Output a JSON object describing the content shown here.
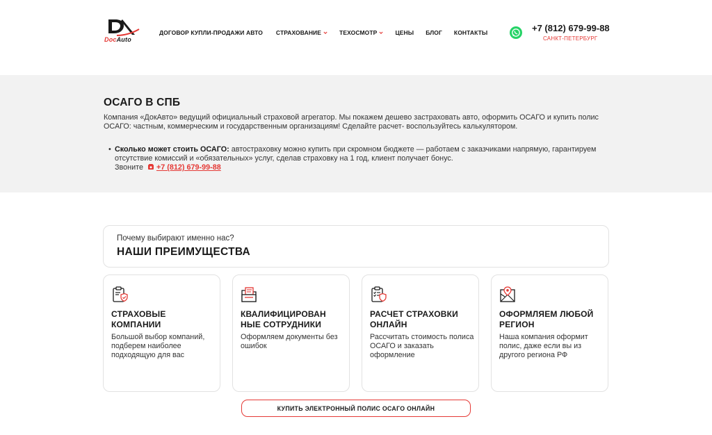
{
  "header": {
    "logo": {
      "word_left": "Doc",
      "word_right": "Auto"
    },
    "nav": [
      {
        "label": "ДОГОВОР КУПЛИ-ПРОДАЖИ АВТО",
        "has_dropdown": false
      },
      {
        "label": "СТРАХОВАНИЕ",
        "has_dropdown": true
      },
      {
        "label": "ТЕХОСМОТР",
        "has_dropdown": true
      },
      {
        "label": "ЦЕНЫ",
        "has_dropdown": false
      },
      {
        "label": "БЛОГ",
        "has_dropdown": false
      },
      {
        "label": "КОНТАКТЫ",
        "has_dropdown": false
      }
    ],
    "phone": "+7 (812) 679-99-88",
    "city": "САНКТ-ПЕТЕРБУРГ",
    "whatsapp_icon": "whatsapp-icon"
  },
  "intro": {
    "title": "ОСАГО В СПБ",
    "paragraph": "Компания «ДокАвто» ведущий официальный страховой агрегатор. Мы покажем дешево застраховать авто, оформить ОСАГО и купить полис ОСАГО: частным, коммерческим и государственным организациям! Сделайте расчет- воспользуйтесь калькулятором.",
    "bullet_bold": "Сколько может стоить ОСАГО:",
    "bullet_text": " автостраховку можно купить при скромном бюджете — работаем с заказчиками напрямую, гарантируем отсутствие комиссий и «обязательных» услуг, сделав страховку на 1 год, клиент получает бонус.",
    "call_label": "Звоните",
    "call_phone": "+7 (812) 679-99-88"
  },
  "advantages": {
    "subtitle": "Почему выбирают именно нас?",
    "title": "НАШИ ПРЕИМУЩЕСТВА",
    "cards": [
      {
        "icon": "insurance-document-icon",
        "title": "СТРАХОВЫЕ КОМПАНИИ",
        "text": "Большой выбор компаний, подберем наиболее подходящую для вас"
      },
      {
        "icon": "folder-icon",
        "title": "КВАЛИФИЦИРОВАН НЫЕ СОТРУДНИКИ",
        "text": "Оформляем документы без ошибок"
      },
      {
        "icon": "checklist-icon",
        "title": "РАСЧЕТ СТРАХОВКИ ОНЛАЙН",
        "text": "Рассчитать стоимость полиса ОСАГО и заказать оформление"
      },
      {
        "icon": "map-pin-icon",
        "title": "ОФОРМЛЯЕМ ЛЮБОЙ РЕГИОН",
        "text": "Наша компания оформит полис, даже если вы из другого региона РФ"
      }
    ]
  },
  "cta": {
    "label": "КУПИТЬ ЭЛЕКТРОННЫЙ ПОЛИС ОСАГО ОНЛАЙН"
  },
  "colors": {
    "accent": "#e53935",
    "whatsapp": "#25d366",
    "intro_bg": "#f2f2f2",
    "border": "#e2e2e2"
  }
}
